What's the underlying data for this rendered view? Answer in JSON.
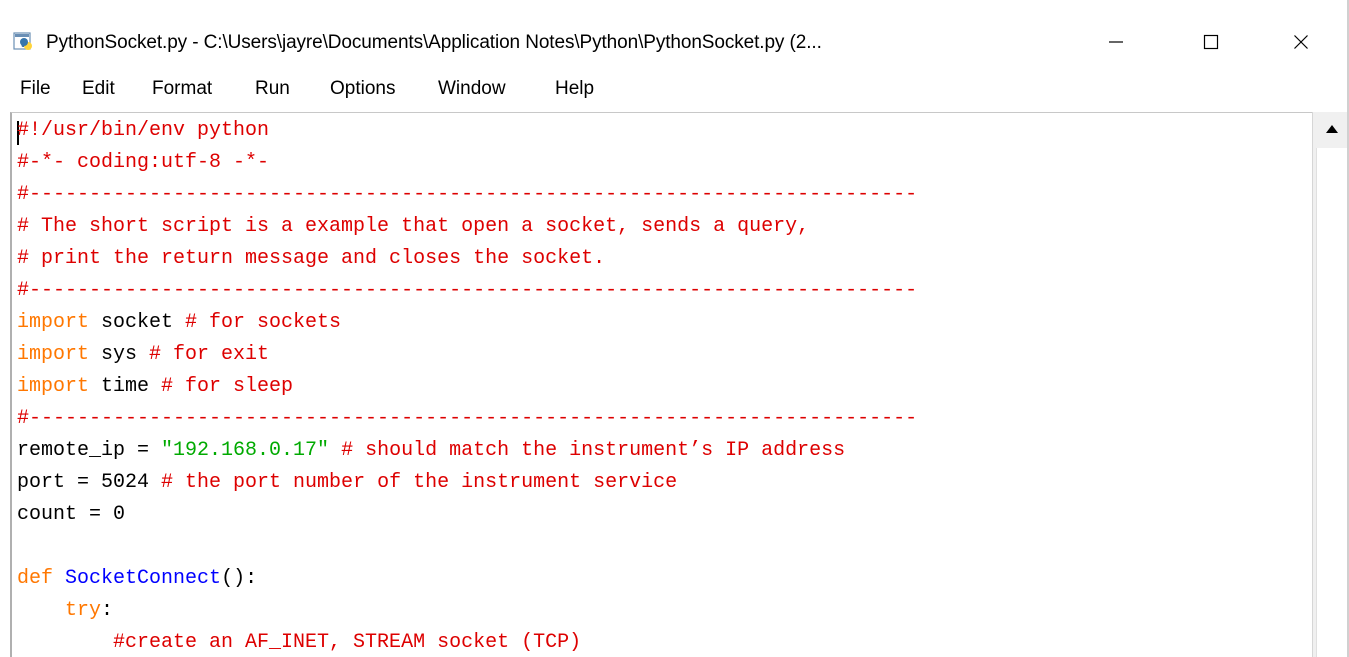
{
  "window": {
    "title": "PythonSocket.py - C:\\Users\\jayre\\Documents\\Application Notes\\Python\\PythonSocket.py (2...",
    "app_icon": "idle-python-icon",
    "controls": {
      "minimize_icon": "minimize-icon",
      "maximize_icon": "maximize-icon",
      "close_icon": "close-icon"
    }
  },
  "menu": {
    "items": [
      "File",
      "Edit",
      "Format",
      "Run",
      "Options",
      "Window",
      "Help"
    ]
  },
  "colors": {
    "keyword": "#ff7700",
    "comment": "#dd0000",
    "string": "#00aa00",
    "function_name": "#0000ff",
    "default_text": "#000000"
  },
  "code": {
    "lines": [
      [
        {
          "t": "#!/usr/bin/env python",
          "c": "cm"
        }
      ],
      [
        {
          "t": "#-*- coding:utf-8 -*-",
          "c": "cm"
        }
      ],
      [
        {
          "t": "#--------------------------------------------------------------------------",
          "c": "cm"
        }
      ],
      [
        {
          "t": "# The short script is a example that open a socket, sends a query,",
          "c": "cm"
        }
      ],
      [
        {
          "t": "# print the return message and closes the socket.",
          "c": "cm"
        }
      ],
      [
        {
          "t": "#--------------------------------------------------------------------------",
          "c": "cm"
        }
      ],
      [
        {
          "t": "import",
          "c": "kw"
        },
        {
          "t": " socket ",
          "c": ""
        },
        {
          "t": "# for sockets",
          "c": "cm"
        }
      ],
      [
        {
          "t": "import",
          "c": "kw"
        },
        {
          "t": " sys ",
          "c": ""
        },
        {
          "t": "# for exit",
          "c": "cm"
        }
      ],
      [
        {
          "t": "import",
          "c": "kw"
        },
        {
          "t": " time ",
          "c": ""
        },
        {
          "t": "# for sleep",
          "c": "cm"
        }
      ],
      [
        {
          "t": "#--------------------------------------------------------------------------",
          "c": "cm"
        }
      ],
      [
        {
          "t": "remote_ip = ",
          "c": ""
        },
        {
          "t": "\"192.168.0.17\"",
          "c": "st"
        },
        {
          "t": " ",
          "c": ""
        },
        {
          "t": "# should match the instrument’s IP address",
          "c": "cm"
        }
      ],
      [
        {
          "t": "port = 5024 ",
          "c": ""
        },
        {
          "t": "# the port number of the instrument service",
          "c": "cm"
        }
      ],
      [
        {
          "t": "count = 0",
          "c": ""
        }
      ],
      [
        {
          "t": "",
          "c": ""
        }
      ],
      [
        {
          "t": "def",
          "c": "kw"
        },
        {
          "t": " ",
          "c": ""
        },
        {
          "t": "SocketConnect",
          "c": "fn"
        },
        {
          "t": "():",
          "c": ""
        }
      ],
      [
        {
          "t": "    ",
          "c": ""
        },
        {
          "t": "try",
          "c": "kw"
        },
        {
          "t": ":",
          "c": ""
        }
      ],
      [
        {
          "t": "        ",
          "c": ""
        },
        {
          "t": "#create an AF_INET, STREAM socket (TCP)",
          "c": "cm"
        }
      ]
    ]
  },
  "scrollbar": {
    "up_icon": "scroll-up-arrow-icon"
  }
}
